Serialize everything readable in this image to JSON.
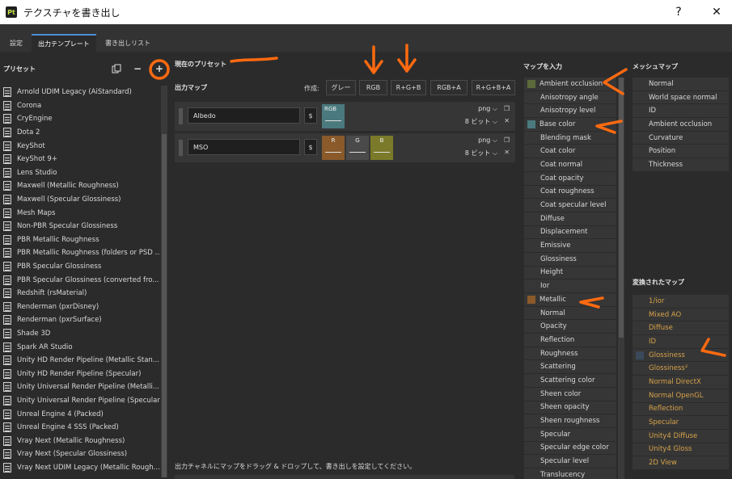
{
  "window": {
    "app_icon": "Pt",
    "title": "テクスチャを書き出し",
    "help": "?",
    "close": "✕"
  },
  "tabs": [
    {
      "label": "設定"
    },
    {
      "label": "出力テンプレート"
    },
    {
      "label": "書き出しリスト"
    }
  ],
  "presets": {
    "header": "プリセット",
    "items": [
      "Arnold UDIM Legacy (AiStandard)",
      "Corona",
      "CryEngine",
      "Dota 2",
      "KeyShot",
      "KeyShot 9+",
      "Lens Studio",
      "Maxwell (Metallic Roughness)",
      "Maxwell (Specular Glossiness)",
      "Mesh Maps",
      "Non-PBR Specular Glossiness",
      "PBR Metallic Roughness",
      "PBR Metallic Roughness (folders or PSD ...",
      "PBR Specular Glossiness",
      "PBR Specular Glossiness (converted fro...",
      "Redshift (rsMaterial)",
      "Renderman (pxrDisney)",
      "Renderman (pxrSurface)",
      "Shade 3D",
      "Spark AR Studio",
      "Unity HD Render Pipeline (Metallic Stan...",
      "Unity HD Render Pipeline (Specular)",
      "Unity Universal Render Pipeline (Metalli...",
      "Unity Universal Render Pipeline (Specular)",
      "Unreal Engine 4 (Packed)",
      "Unreal Engine 4 SSS (Packed)",
      "Vray Next (Metallic Roughness)",
      "Vray Next (Specular Glossiness)",
      "Vray Next UDIM Legacy (Metallic Rough..."
    ],
    "duplicate_icon": "copy-icon",
    "remove_label": "−",
    "add_label": "+"
  },
  "current_preset": {
    "header": "現在のプリセット"
  },
  "output_maps": {
    "header": "出力マップ",
    "create_label": "作成:",
    "create_buttons": [
      "グレー",
      "RGB",
      "R+G+B",
      "RGB+A",
      "R+G+B+A"
    ],
    "rows": [
      {
        "name": "Albedo",
        "dollar": "$",
        "channels": [
          {
            "label": "RGB",
            "color": "#4a7a7e"
          }
        ],
        "format": "png",
        "bits": "8 ビット"
      },
      {
        "name": "MSO",
        "dollar": "$",
        "channels": [
          {
            "label": "R",
            "color": "#8a5a2a"
          },
          {
            "label": "G",
            "color": "#4a4a4a"
          },
          {
            "label": "B",
            "color": "#7a7a2a"
          }
        ],
        "format": "png",
        "bits": "8 ビット"
      }
    ],
    "hint": "出力チャネルにマップをドラッグ & ドロップして、書き出しを設定してください。"
  },
  "input_maps": {
    "header": "マップを入力",
    "items": [
      {
        "label": "Ambient occlusion",
        "swatch": "#5a6a3a"
      },
      {
        "label": "Anisotropy angle"
      },
      {
        "label": "Anisotropy level"
      },
      {
        "label": "Base color",
        "swatch": "#4a7a7e"
      },
      {
        "label": "Blending mask"
      },
      {
        "label": "Coat color"
      },
      {
        "label": "Coat normal"
      },
      {
        "label": "Coat opacity"
      },
      {
        "label": "Coat roughness"
      },
      {
        "label": "Coat specular level"
      },
      {
        "label": "Diffuse"
      },
      {
        "label": "Displacement"
      },
      {
        "label": "Emissive"
      },
      {
        "label": "Glossiness"
      },
      {
        "label": "Height"
      },
      {
        "label": "Ior"
      },
      {
        "label": "Metallic",
        "swatch": "#8a5a2a"
      },
      {
        "label": "Normal"
      },
      {
        "label": "Opacity"
      },
      {
        "label": "Reflection"
      },
      {
        "label": "Roughness"
      },
      {
        "label": "Scattering"
      },
      {
        "label": "Scattering color"
      },
      {
        "label": "Sheen color"
      },
      {
        "label": "Sheen opacity"
      },
      {
        "label": "Sheen roughness"
      },
      {
        "label": "Specular"
      },
      {
        "label": "Specular edge color"
      },
      {
        "label": "Specular level"
      },
      {
        "label": "Translucency"
      }
    ]
  },
  "mesh_maps": {
    "header": "メッシュマップ",
    "items": [
      "Normal",
      "World space normal",
      "ID",
      "Ambient occlusion",
      "Curvature",
      "Position",
      "Thickness"
    ]
  },
  "converted_maps": {
    "header": "変換されたマップ",
    "items": [
      {
        "label": "1/ior"
      },
      {
        "label": "Mixed AO"
      },
      {
        "label": "Diffuse"
      },
      {
        "label": "ID"
      },
      {
        "label": "Glossiness",
        "swatch": "#3a4a5a"
      },
      {
        "label": "Glossiness²"
      },
      {
        "label": "Normal DirectX"
      },
      {
        "label": "Normal OpenGL"
      },
      {
        "label": "Reflection"
      },
      {
        "label": "Specular"
      },
      {
        "label": "Unity4 Diffuse"
      },
      {
        "label": "Unity4 Gloss"
      },
      {
        "label": "2D View"
      }
    ]
  },
  "colors": {
    "accent": "#4a8fd6",
    "annotation": "#ff6a10",
    "converted_text": "#d6a24a"
  }
}
